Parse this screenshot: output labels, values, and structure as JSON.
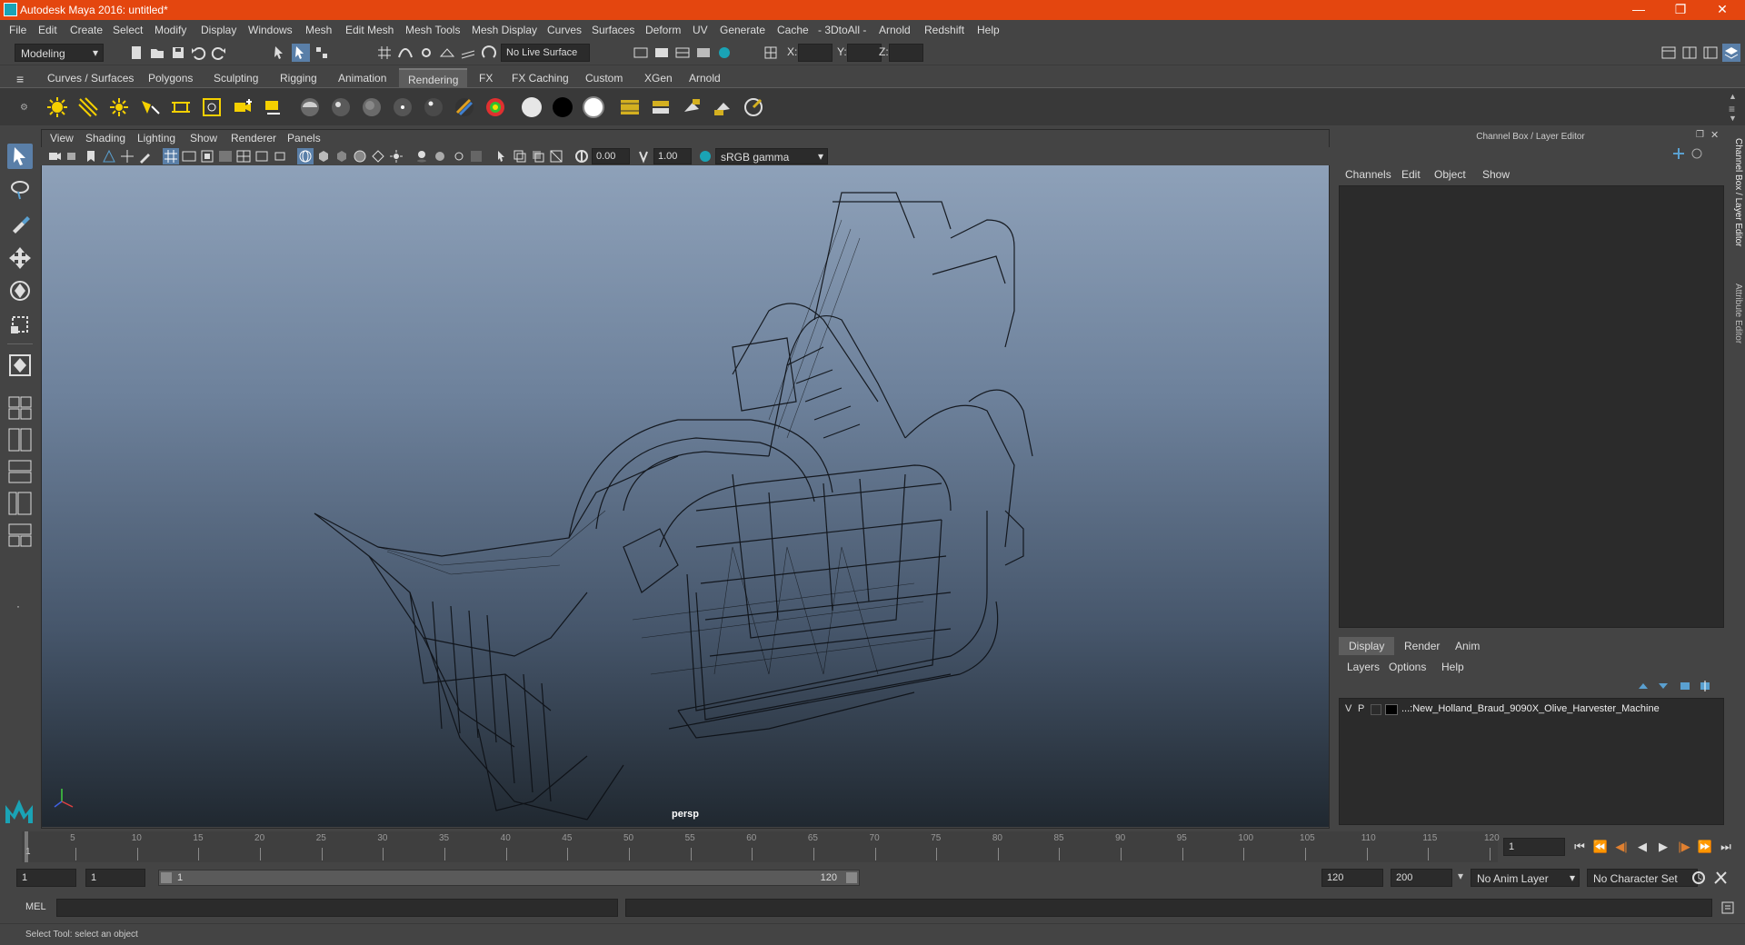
{
  "window": {
    "title": "Autodesk Maya 2016: untitled*",
    "controls": [
      "—",
      "❐",
      "✕"
    ]
  },
  "menubar": [
    "File",
    "Edit",
    "Create",
    "Select",
    "Modify",
    "Display",
    "Windows",
    "Mesh",
    "Edit Mesh",
    "Mesh Tools",
    "Mesh Display",
    "Curves",
    "Surfaces",
    "Deform",
    "UV",
    "Generate",
    "Cache",
    "- 3DtoAll -",
    "Arnold",
    "Redshift",
    "Help"
  ],
  "statusline": {
    "menuset": "Modeling",
    "live_surface": "No Live Surface",
    "x_label": "X:",
    "y_label": "Y:",
    "z_label": "Z:"
  },
  "shelf_tabs": [
    "Curves / Surfaces",
    "Polygons",
    "Sculpting",
    "Rigging",
    "Animation",
    "Rendering",
    "FX",
    "FX Caching",
    "Custom",
    "XGen",
    "Arnold"
  ],
  "active_shelf_tab": "Rendering",
  "viewport": {
    "menus": [
      "View",
      "Shading",
      "Lighting",
      "Show",
      "Renderer",
      "Panels"
    ],
    "exposure": "0.00",
    "gamma": "1.00",
    "color_space": "sRGB gamma",
    "camera": "persp"
  },
  "channelbox": {
    "title": "Channel Box / Layer Editor",
    "menus": [
      "Channels",
      "Edit",
      "Object",
      "Show"
    ],
    "layer_tabs": [
      "Display",
      "Render",
      "Anim"
    ],
    "active_layer_tab": "Display",
    "layer_menus": [
      "Layers",
      "Options",
      "Help"
    ],
    "layer": {
      "v": "V",
      "p": "P",
      "name": "...:New_Holland_Braud_9090X_Olive_Harvester_Machine"
    }
  },
  "side_tabs": [
    "Channel Box / Layer Editor",
    "Attribute Editor"
  ],
  "timeslider": {
    "ticks": [
      5,
      10,
      15,
      20,
      25,
      30,
      35,
      40,
      45,
      50,
      55,
      60,
      65,
      70,
      75,
      80,
      85,
      90,
      95,
      100,
      105,
      110,
      115,
      120
    ],
    "start_label": "1",
    "current_frame": "1"
  },
  "rangeslider": {
    "start": "1",
    "playback_start": "1",
    "range_start": "1",
    "range_end": "120",
    "playback_end": "120",
    "end": "200",
    "anim_layer": "No Anim Layer",
    "character_set": "No Character Set"
  },
  "cmdline": {
    "label": "MEL"
  },
  "helpline": {
    "text": "Select Tool: select an object"
  },
  "colors": {
    "titlebar": "#e4460f",
    "accent": "#1aa3b5"
  }
}
